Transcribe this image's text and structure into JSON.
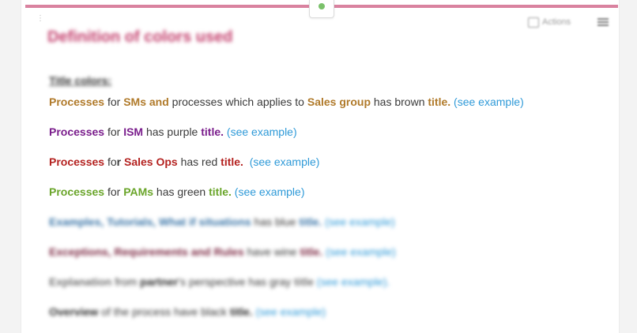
{
  "colors": {
    "accent_bar": "#d9829f",
    "title": "#c33e6c",
    "brown": "#b07a2a",
    "purple": "#7a1d8c",
    "red": "#b42220",
    "green": "#6aa52a",
    "blue": "#3b76a8",
    "wine": "#7e2b45",
    "gray": "#707070",
    "link": "#2f9ad8"
  },
  "header": {
    "actions_label": "Actions",
    "actions_icon": "panel-icon",
    "menu_icon": "menu-icon"
  },
  "page_title": "Definition of colors used",
  "section_title": "Title colors:",
  "lines": {
    "brown": {
      "processes": "Processes",
      "for": " for ",
      "sms_and": "SMs and",
      "processes_applies": " processes which applies to ",
      "sales_group": "Sales group",
      "has_brown": " has brown ",
      "title": "title.",
      "link": "(see example)"
    },
    "purple": {
      "processes": "Processes",
      "for": " for ",
      "ism": "ISM",
      "has_purple": " has purple ",
      "title": "title.",
      "link": "(see example)"
    },
    "red": {
      "processes": "Processes",
      "fo": " fo",
      "r": "r",
      "sales_ops": "Sales Ops",
      "has_red": " has red ",
      "title": "title.",
      "link": "(see example)"
    },
    "green": {
      "processes": "Processes",
      "for": " for ",
      "pams": "PAMs",
      "has_green": " has green ",
      "title": "title.",
      "link": "(see example)"
    },
    "blue": {
      "subject": "Examples, Tutorials, What if situations",
      "has_blue": " has blue ",
      "title": "title.",
      "link": "(see example)"
    },
    "wine": {
      "subject": "Exceptions, Requirements and Rules",
      "has_wine": " have wine ",
      "title": "title.",
      "link": "(see example)"
    },
    "gray": {
      "subject": "Explanation",
      "from": " from ",
      "partner": "partner",
      "perspective": "'s perspective has gray ",
      "title": "title",
      "link": "(see example)."
    },
    "black": {
      "subject": "Overview",
      "rest": " of the process have black ",
      "title": "title.",
      "link": "(see example)"
    }
  }
}
